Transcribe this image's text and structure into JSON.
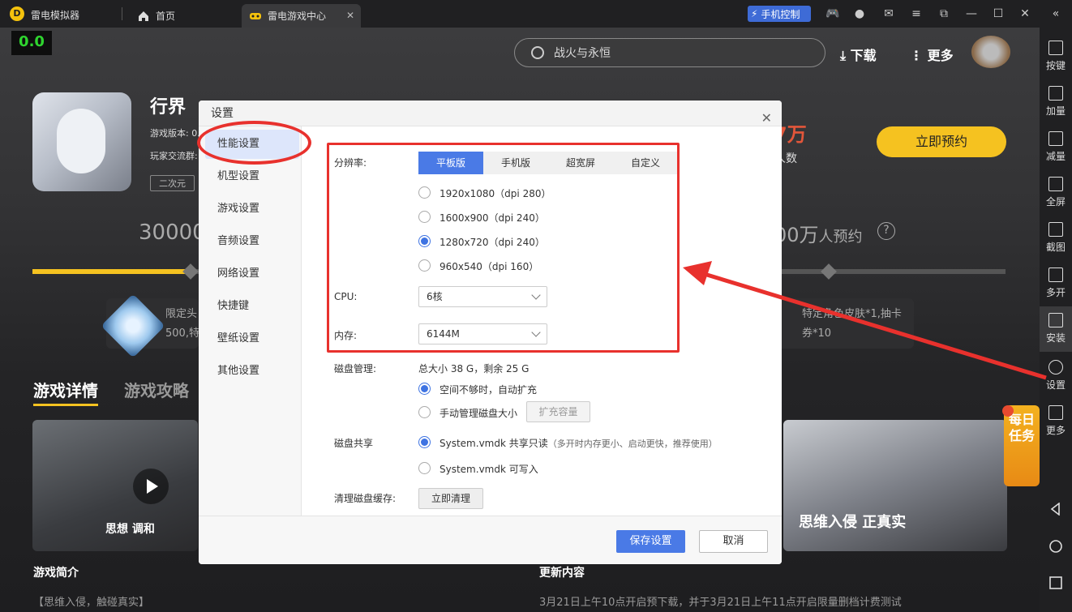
{
  "app": {
    "title": "雷电模拟器",
    "logo_glyph": "D"
  },
  "tabs": {
    "home": "首页",
    "center": "雷电游戏中心"
  },
  "titlebar": {
    "phone_control": "手机控制"
  },
  "fps": "0.0",
  "header": {
    "search_placeholder": "战火与永恒",
    "download": "下载",
    "more": "更多"
  },
  "game": {
    "title": "行界",
    "version_label": "游戏版本: 0.",
    "community_label": "玩家交流群:",
    "tag": "二次元",
    "big_number": "30000",
    "reserve_button": "立即预约",
    "reserve_count": "7万",
    "reserve_count_label": "人数",
    "right_stat": "00万",
    "right_stat_suffix": "人预约",
    "progress_fraction": 0.16
  },
  "rewards": {
    "left": [
      "限定头",
      "500,特"
    ],
    "right": [
      "特定角色皮肤*1,抽卡",
      "券*10"
    ]
  },
  "detail_tabs": {
    "details": "游戏详情",
    "guide": "游戏攻略"
  },
  "media": {
    "left_caption": "思想 调和",
    "right_caption": "思维入侵 正真实"
  },
  "sections": {
    "intro_title": "游戏简介",
    "intro_text": "【思维入侵，触碰真实】",
    "update_title": "更新内容",
    "update_text": "3月21日上午10点开启预下载，并于3月21日上午11点开启限量删档计费测试"
  },
  "daily_task": "每日任务",
  "sidebar": {
    "items": [
      {
        "label": "按键",
        "icon": "keyboard-icon"
      },
      {
        "label": "加量",
        "icon": "volume-up-icon"
      },
      {
        "label": "减量",
        "icon": "volume-down-icon"
      },
      {
        "label": "全屏",
        "icon": "fullscreen-icon"
      },
      {
        "label": "截图",
        "icon": "scissors-icon"
      },
      {
        "label": "多开",
        "icon": "multi-instance-icon"
      },
      {
        "label": "安装",
        "icon": "apk-icon"
      },
      {
        "label": "设置",
        "icon": "gear-icon"
      },
      {
        "label": "更多",
        "icon": "more-icon"
      }
    ]
  },
  "dialog": {
    "title": "设置",
    "nav": [
      "性能设置",
      "机型设置",
      "游戏设置",
      "音频设置",
      "网络设置",
      "快捷键",
      "壁纸设置",
      "其他设置"
    ],
    "resolution_label": "分辨率:",
    "resolution_tabs": [
      "平板版",
      "手机版",
      "超宽屏",
      "自定义"
    ],
    "resolution_options": [
      "1920x1080（dpi 280）",
      "1600x900（dpi 240）",
      "1280x720（dpi 240）",
      "960x540（dpi 160）"
    ],
    "cpu_label": "CPU:",
    "cpu_value": "6核",
    "memory_label": "内存:",
    "memory_value": "6144M",
    "disk_label": "磁盘管理:",
    "disk_info": "总大小 38 G，剩余 25 G",
    "disk_auto": "空间不够时，自动扩充",
    "disk_manual": "手动管理磁盘大小",
    "disk_expand": "扩充容量",
    "share_label": "磁盘共享",
    "share_readonly": "System.vmdk 共享只读",
    "share_readonly_note": "（多开时内存更小、启动更快，推荐使用）",
    "share_writable": "System.vmdk 可写入",
    "cache_label": "清理磁盘缓存:",
    "cache_button": "立即清理",
    "save": "保存设置",
    "cancel": "取消"
  },
  "colors": {
    "accent": "#4a7ae6",
    "highlight": "#e8312d",
    "brand": "#f5c220"
  }
}
